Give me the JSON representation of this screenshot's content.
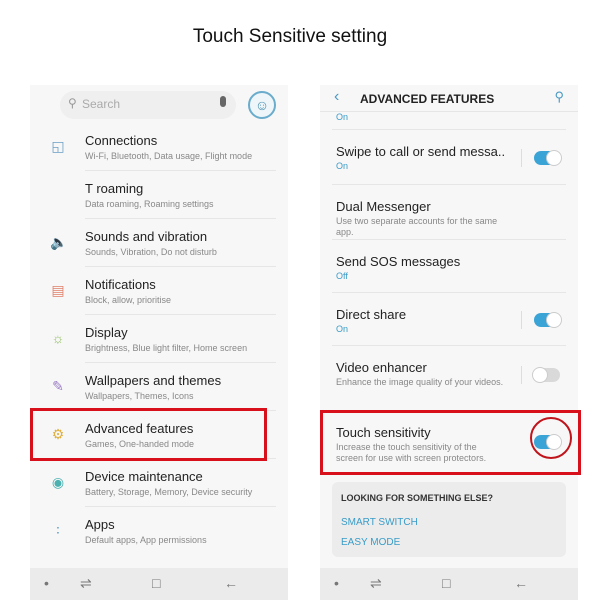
{
  "title": "Touch Sensitive setting",
  "left": {
    "search_placeholder": "Search",
    "items": [
      {
        "title": "Connections",
        "sub": "Wi-Fi, Bluetooth, Data usage, Flight mode",
        "icon": "connections-icon",
        "color": "#6b9ec4"
      },
      {
        "title": "T roaming",
        "sub": "Data roaming, Roaming settings",
        "icon": "",
        "color": ""
      },
      {
        "title": "Sounds and vibration",
        "sub": "Sounds, Vibration, Do not disturb",
        "icon": "speaker-icon",
        "color": "#6b84c4"
      },
      {
        "title": "Notifications",
        "sub": "Block, allow, prioritise",
        "icon": "notifications-icon",
        "color": "#e0806a"
      },
      {
        "title": "Display",
        "sub": "Brightness, Blue light filter, Home screen",
        "icon": "display-icon",
        "color": "#8cbc5a"
      },
      {
        "title": "Wallpapers and themes",
        "sub": "Wallpapers, Themes, Icons",
        "icon": "brush-icon",
        "color": "#9a7cc4"
      },
      {
        "title": "Advanced features",
        "sub": "Games, One-handed mode",
        "icon": "gear-plus-icon",
        "color": "#e0b040"
      },
      {
        "title": "Device maintenance",
        "sub": "Battery, Storage, Memory, Device security",
        "icon": "maintenance-icon",
        "color": "#4ab0b0"
      },
      {
        "title": "Apps",
        "sub": "Default apps, App permissions",
        "icon": "apps-icon",
        "color": "#5a9cc4"
      }
    ]
  },
  "right": {
    "header": "ADVANCED FEATURES",
    "partial_status": "On",
    "items": [
      {
        "title": "Swipe to call or send messa..",
        "sub": "On",
        "toggle": true
      },
      {
        "title": "Dual Messenger",
        "sub": "Use two separate accounts for the same app.",
        "toggle": null
      },
      {
        "title": "Send SOS messages",
        "sub": "Off",
        "toggle": null
      },
      {
        "title": "Direct share",
        "sub": "On",
        "toggle": true
      },
      {
        "title": "Video enhancer",
        "sub": "Enhance the image quality of your videos.",
        "toggle": false
      },
      {
        "title": "Touch sensitivity",
        "sub": "Increase the touch sensitivity of the screen for use with screen protectors.",
        "toggle": true
      }
    ],
    "card": {
      "heading": "LOOKING FOR SOMETHING ELSE?",
      "links": [
        "SMART SWITCH",
        "EASY MODE"
      ]
    }
  },
  "colors": {
    "accent": "#3ba4d6",
    "highlight": "#d8101c"
  }
}
